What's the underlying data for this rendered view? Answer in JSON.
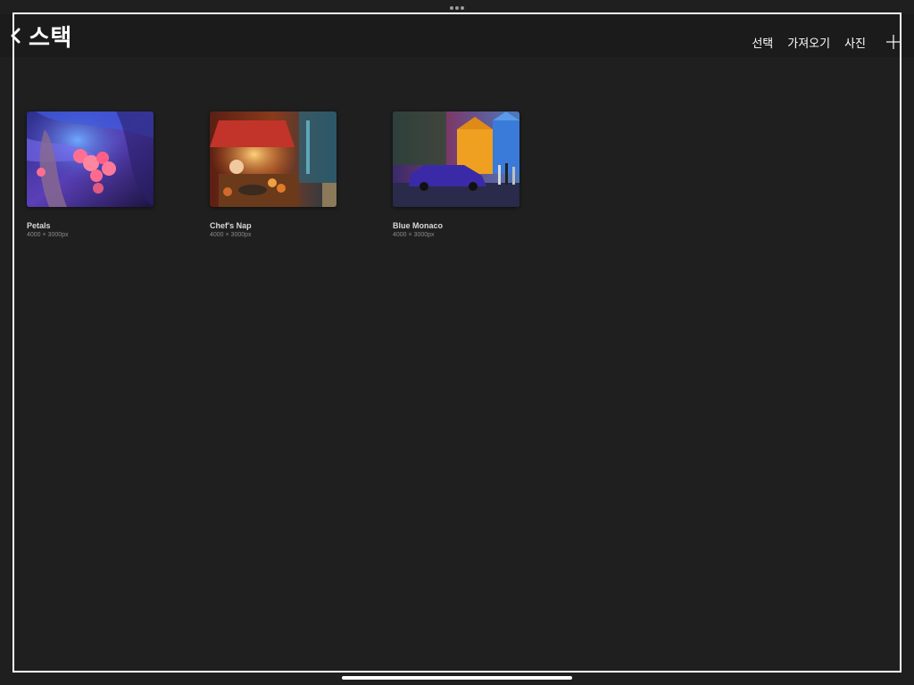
{
  "header": {
    "back_icon": "chevron-left-icon",
    "title": "스택"
  },
  "toolbar": {
    "select_label": "선택",
    "import_label": "가져오기",
    "photo_label": "사진",
    "add_icon": "plus-icon"
  },
  "artworks": [
    {
      "title": "Petals",
      "size": "4000 × 3000px"
    },
    {
      "title": "Chef's Nap",
      "size": "4000 × 3000px"
    },
    {
      "title": "Blue Monaco",
      "size": "4000 × 3000px"
    }
  ],
  "colors": {
    "background": "#1f1f1f",
    "topbar": "#1b1b1b",
    "text": "#ffffff",
    "subtext": "#8a8a8a"
  }
}
